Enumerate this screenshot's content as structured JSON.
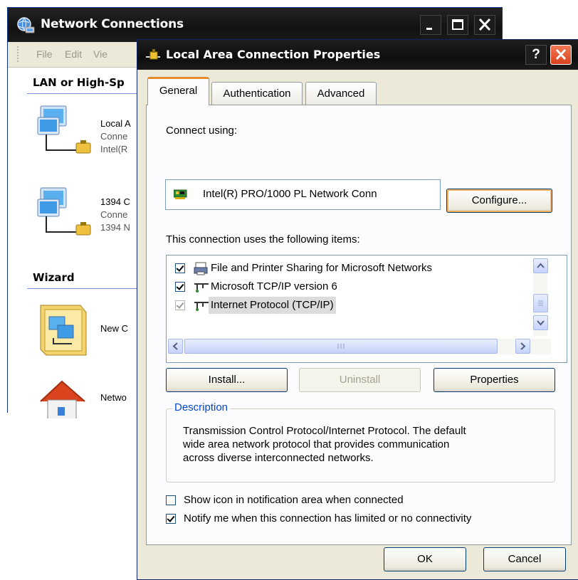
{
  "network_connections": {
    "title": "Network Connections",
    "menu": [
      "File",
      "Edit",
      "Vie"
    ],
    "groups": {
      "lan": "LAN or High-Sp",
      "wizard": "Wizard"
    },
    "connections": [
      {
        "lines": [
          "Local A",
          "Conne",
          "Intel(R"
        ]
      },
      {
        "lines": [
          "1394 C",
          "Conne",
          "1394 N"
        ]
      }
    ],
    "wizard_items": [
      {
        "label": "New C"
      },
      {
        "label": "Netwo"
      }
    ]
  },
  "dialog": {
    "title": "Local Area Connection Properties",
    "help_glyph": "?",
    "tabs": [
      "General",
      "Authentication",
      "Advanced"
    ],
    "active_tab": "General",
    "connect_using_label": "Connect using:",
    "adapter_name": "Intel(R) PRO/1000 PL Network Conn",
    "configure_button": "Configure...",
    "items_label": "This connection uses the following items:",
    "items": [
      {
        "label": "File and Printer Sharing for Microsoft Networks",
        "checked": true,
        "icon": "printer-sharing-icon"
      },
      {
        "label": "Microsoft TCP/IP version 6",
        "checked": true,
        "icon": "protocol-icon"
      },
      {
        "label": "Internet Protocol (TCP/IP)",
        "checked": true,
        "icon": "protocol-icon",
        "selected": true
      }
    ],
    "install_button": "Install...",
    "uninstall_button": "Uninstall",
    "properties_button": "Properties",
    "description_label": "Description",
    "description_lines": [
      "Transmission Control Protocol/Internet Protocol. The default",
      "wide area network protocol that provides communication",
      "across diverse interconnected networks."
    ],
    "show_icon_option": "Show icon in notification area when connected",
    "show_icon_checked": false,
    "notify_option": "Notify me when this connection has limited or no connectivity",
    "notify_checked": true,
    "ok_button": "OK",
    "cancel_button": "Cancel"
  },
  "colors": {
    "xp_dialog_bg": "#ece9d8",
    "title_bar": "#121212",
    "close_red": "#d9411c",
    "tab_accent": "#e68b2c",
    "description_blue": "#0046d5"
  }
}
